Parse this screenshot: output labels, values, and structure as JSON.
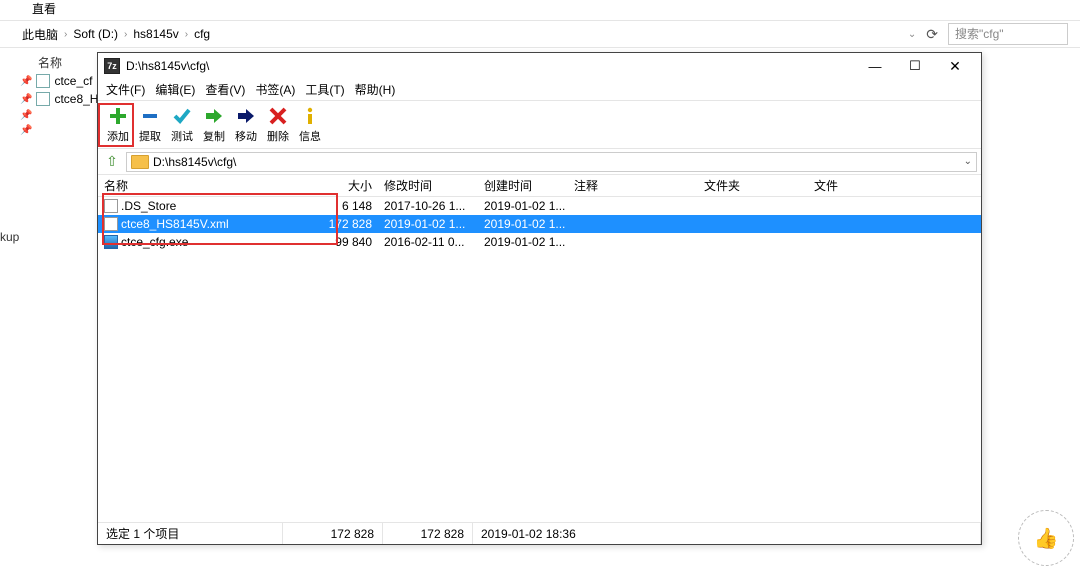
{
  "explorer": {
    "tab_title": "直看",
    "breadcrumb": [
      "此电脑",
      "Soft (D:)",
      "hs8145v",
      "cfg"
    ],
    "name_header": "名称",
    "search_placeholder": "搜索\"cfg\"",
    "bg_files": [
      {
        "name": "ctce_cf"
      },
      {
        "name": "ctce8_H"
      }
    ],
    "kup_label": "kup"
  },
  "zip": {
    "title": "D:\\hs8145v\\cfg\\",
    "menu": [
      "文件(F)",
      "编辑(E)",
      "查看(V)",
      "书签(A)",
      "工具(T)",
      "帮助(H)"
    ],
    "toolbar": [
      {
        "key": "add",
        "label": "添加"
      },
      {
        "key": "extract",
        "label": "提取"
      },
      {
        "key": "test",
        "label": "测试"
      },
      {
        "key": "copy",
        "label": "复制"
      },
      {
        "key": "move",
        "label": "移动"
      },
      {
        "key": "delete",
        "label": "删除"
      },
      {
        "key": "info",
        "label": "信息"
      }
    ],
    "path": "D:\\hs8145v\\cfg\\",
    "columns": {
      "name": "名称",
      "size": "大小",
      "mod": "修改时间",
      "create": "创建时间",
      "comment": "注释",
      "folder": "文件夹",
      "file": "文件"
    },
    "files": [
      {
        "name": ".DS_Store",
        "size": "6 148",
        "mod": "2017-10-26 1...",
        "create": "2019-01-02 1...",
        "selected": false,
        "icon": "doc"
      },
      {
        "name": "ctce8_HS8145V.xml",
        "size": "172 828",
        "mod": "2019-01-02 1...",
        "create": "2019-01-02 1...",
        "selected": true,
        "icon": "doc"
      },
      {
        "name": "ctce_cfg.exe",
        "size": "99 840",
        "mod": "2016-02-11 0...",
        "create": "2019-01-02 1...",
        "selected": false,
        "icon": "exe"
      }
    ],
    "status": {
      "selection": "选定 1 个项目",
      "size1": "172 828",
      "size2": "172 828",
      "date": "2019-01-02 18:36"
    }
  }
}
